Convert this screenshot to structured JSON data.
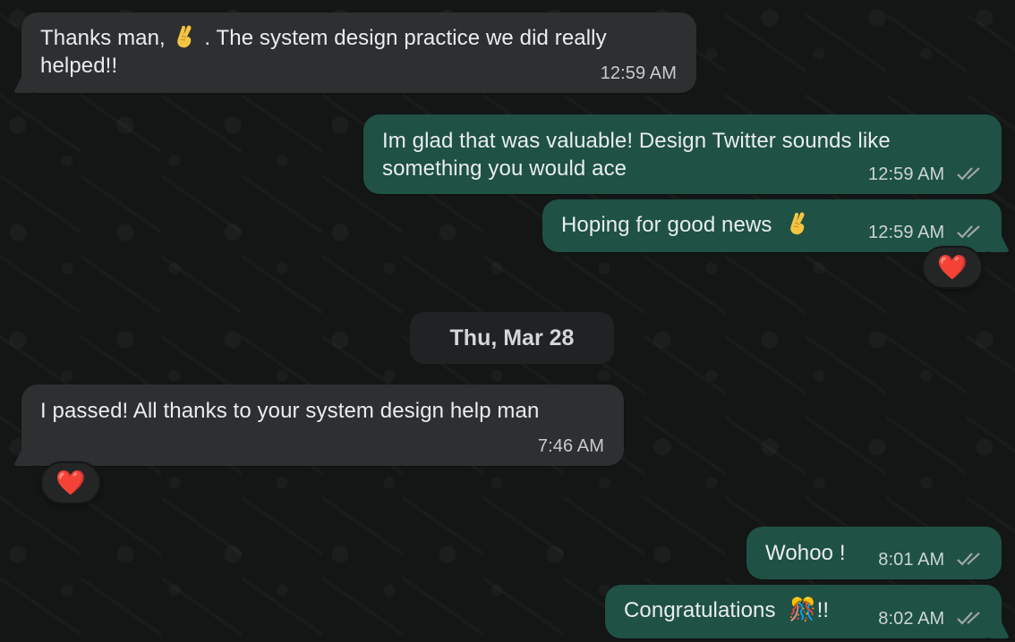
{
  "messages": {
    "m1": {
      "text_before_emoji": "Thanks man,",
      "text_after_emoji": ". The system design practice we did really",
      "text_line_2": "helped!!",
      "time": "12:59 AM"
    },
    "m2": {
      "line_1": "Im glad that was valuable! Design Twitter sounds like",
      "line_2": "something you would ace",
      "time": "12:59 AM"
    },
    "m3": {
      "text": "Hoping for good news",
      "time": "12:59 AM",
      "reaction": "❤️"
    },
    "date_separator": "Thu, Mar 28",
    "m4": {
      "text": "I passed! All thanks to your system design help man",
      "time": "7:46 AM",
      "reaction": "❤️"
    },
    "m5": {
      "text": "Wohoo !",
      "time": "8:01 AM"
    },
    "m6": {
      "text_before_emoji": "Congratulations",
      "emoji": "🎊",
      "text_after_emoji": "!!",
      "time": "8:02 AM"
    }
  },
  "colors": {
    "background": "#161717",
    "incoming_bubble": "#2e2f30",
    "outgoing_bubble": "#1f5145",
    "read_ticks": "#9fa8a5"
  },
  "icons": {
    "fingers_crossed": "fingers-crossed-icon",
    "read_receipt": "double-check-icon"
  }
}
